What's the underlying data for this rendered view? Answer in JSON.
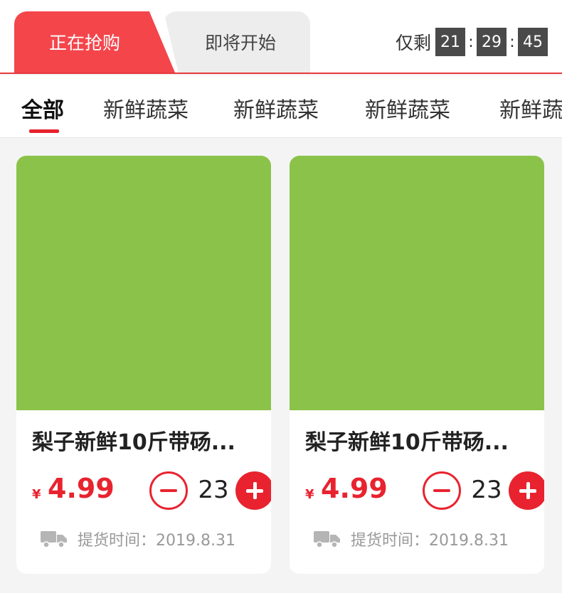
{
  "sale_tabs": {
    "active_label": "正在抢购",
    "inactive_label": "即将开始"
  },
  "countdown": {
    "label": "仅剩",
    "hours": "21",
    "minutes": "29",
    "seconds": "45",
    "separator": ":"
  },
  "categories": [
    {
      "label": "全部"
    },
    {
      "label": "新鲜蔬菜"
    },
    {
      "label": "新鲜蔬菜"
    },
    {
      "label": "新鲜蔬菜"
    },
    {
      "label": "新鲜蔬"
    }
  ],
  "products": [
    {
      "title": "梨子新鲜10斤带砀...",
      "currency": "¥",
      "price": "4.99",
      "quantity": "23",
      "pickup_label": "提货时间：",
      "pickup_date": "2019.8.31",
      "image_color": "#8bc34a"
    },
    {
      "title": "梨子新鲜10斤带砀...",
      "currency": "¥",
      "price": "4.99",
      "quantity": "23",
      "pickup_label": "提货时间：",
      "pickup_date": "2019.8.31",
      "image_color": "#8bc34a"
    }
  ],
  "colors": {
    "accent": "#e8232f",
    "active_tab": "#f4454b",
    "countdown_box": "#4a4a4a"
  },
  "icons": [
    "truck-icon",
    "minus-icon",
    "plus-icon"
  ]
}
